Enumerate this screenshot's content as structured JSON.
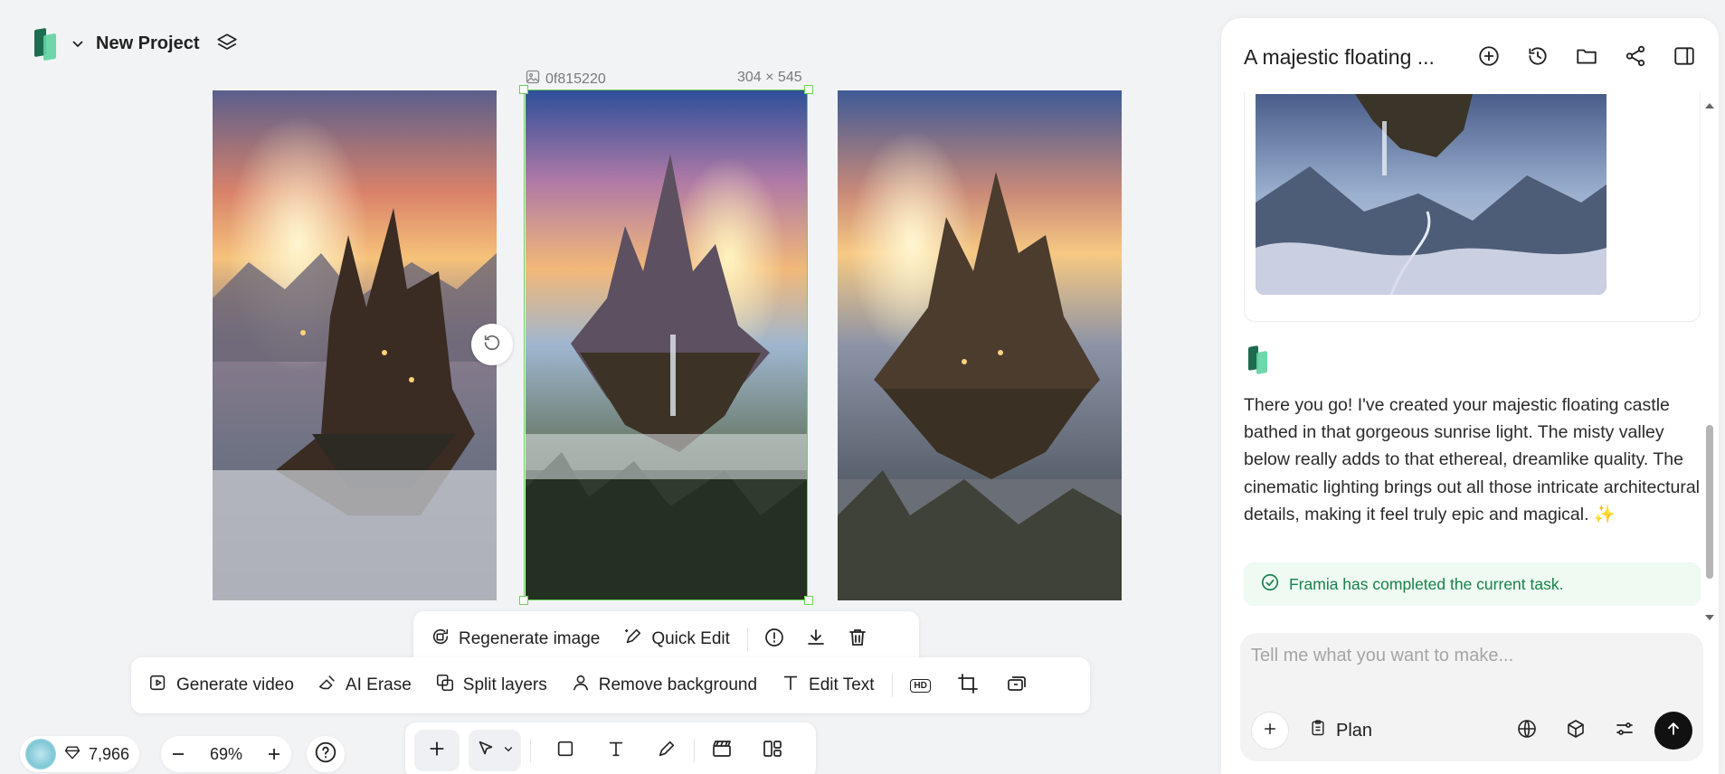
{
  "header": {
    "project_name": "New Project"
  },
  "canvas": {
    "selected_image": {
      "id": "0f815220",
      "dimensions": "304 × 545"
    }
  },
  "selection_toolbar": {
    "regenerate_label": "Regenerate image",
    "quick_edit_label": "Quick Edit"
  },
  "edit_toolbar": {
    "generate_video_label": "Generate video",
    "ai_erase_label": "AI Erase",
    "split_layers_label": "Split layers",
    "remove_background_label": "Remove background",
    "edit_text_label": "Edit Text",
    "hd_label": "HD"
  },
  "status_bar": {
    "credits": "7,966",
    "zoom": "69%"
  },
  "chat": {
    "title": "A majestic floating ...",
    "message": "There you go! I've created your majestic floating castle bathed in that gorgeous sunrise light. The misty valley below really adds to that ethereal, dreamlike quality. The cinematic lighting brings out all those intricate architectural details, making it feel truly epic and magical. ✨",
    "status": "Framia has completed the current task.",
    "input_placeholder": "Tell me what you want to make...",
    "plan_label": "Plan"
  },
  "colors": {
    "accent_green": "#1a7f4b",
    "selection_green": "#6ccf5a",
    "status_bg": "#eefaf2"
  }
}
